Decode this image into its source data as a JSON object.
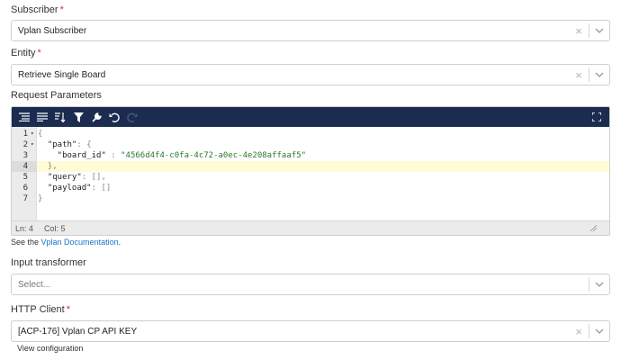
{
  "subscriber": {
    "label": "Subscriber",
    "required_mark": "*",
    "value": "Vplan Subscriber",
    "clear_glyph": "×"
  },
  "entity": {
    "label": "Entity",
    "required_mark": "*",
    "value": "Retrieve Single Board",
    "clear_glyph": "×"
  },
  "request_parameters": {
    "label": "Request Parameters",
    "toolbar_icons": [
      "format-icon",
      "compact-icon",
      "sort-icon",
      "filter-icon",
      "repair-icon",
      "undo-icon",
      "redo-icon",
      "fullscreen-icon"
    ],
    "lines": [
      {
        "num": "1",
        "fold": "▾",
        "parts": [
          {
            "c": "p",
            "t": "{"
          }
        ]
      },
      {
        "num": "2",
        "fold": "▾",
        "parts": [
          {
            "c": "k",
            "t": "  \"path\""
          },
          {
            "c": "p",
            "t": ": {"
          }
        ]
      },
      {
        "num": "3",
        "fold": "",
        "parts": [
          {
            "c": "k",
            "t": "    \"board_id\""
          },
          {
            "c": "p",
            "t": " : "
          },
          {
            "c": "s",
            "t": "\"4566d4f4-c0fa-4c72-a0ec-4e208affaaf5\""
          }
        ]
      },
      {
        "num": "4",
        "fold": "",
        "parts": [
          {
            "c": "p",
            "t": "  },"
          }
        ]
      },
      {
        "num": "5",
        "fold": "",
        "parts": [
          {
            "c": "k",
            "t": "  \"query\""
          },
          {
            "c": "p",
            "t": ": [],"
          }
        ]
      },
      {
        "num": "6",
        "fold": "",
        "parts": [
          {
            "c": "k",
            "t": "  \"payload\""
          },
          {
            "c": "p",
            "t": ": []"
          }
        ]
      },
      {
        "num": "7",
        "fold": "",
        "parts": [
          {
            "c": "p",
            "t": "}"
          }
        ]
      }
    ],
    "active_line": 4,
    "status": {
      "ln": "Ln: 4",
      "col": "Col: 5"
    }
  },
  "help": {
    "prefix": "See the ",
    "link": "Vplan Documentation",
    "suffix": "."
  },
  "input_transformer": {
    "label": "Input transformer",
    "placeholder": "Select..."
  },
  "http_client": {
    "label": "HTTP Client",
    "required_mark": "*",
    "value": "[ACP-176] Vplan CP API KEY",
    "clear_glyph": "×",
    "view_config": "View configuration"
  },
  "colors": {
    "toolbar": "#1b2c50",
    "required": "#d9302c",
    "link": "#1a73c8",
    "string": "#2b7a2b",
    "active_line": "#fffbd6"
  }
}
